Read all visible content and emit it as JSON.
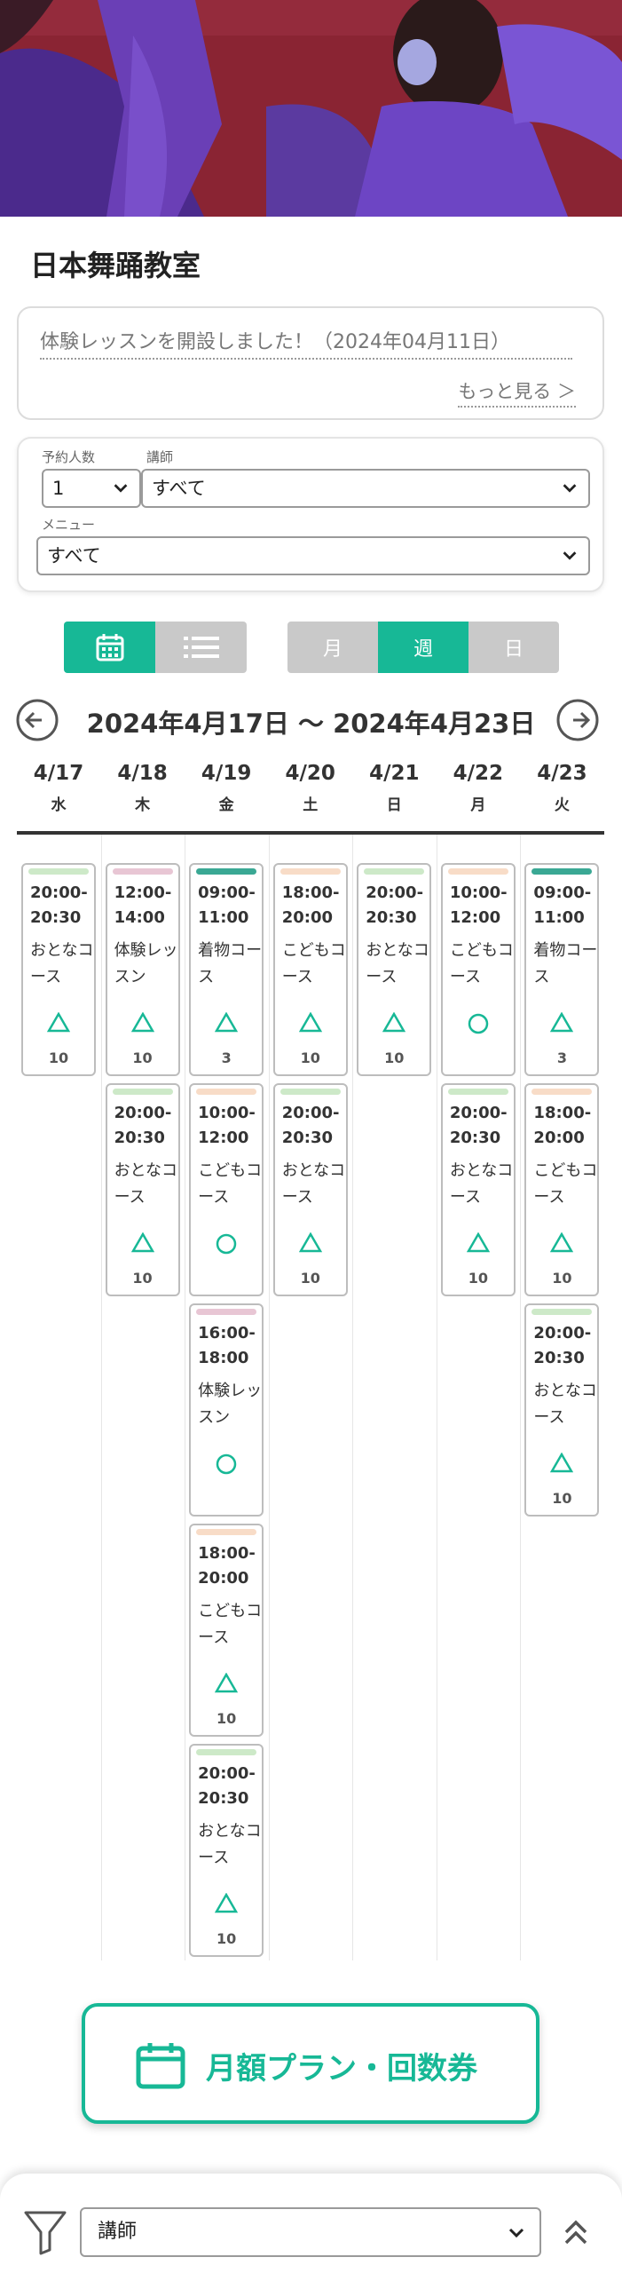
{
  "studio": {
    "title": "日本舞踊教室"
  },
  "notice": {
    "text": "体験レッスンを開設しました！（2024年04月11日）",
    "more": "もっと見る ＞"
  },
  "filters": {
    "people_label": "予約人数",
    "people_value": "1",
    "teacher_label": "講師",
    "teacher_value": "すべて",
    "menu_label": "メニュー",
    "menu_value": "すべて"
  },
  "view_toggle": {
    "calendar_icon": "calendar-icon",
    "list_icon": "list-icon"
  },
  "period": {
    "month": "月",
    "week": "週",
    "day": "日",
    "active": "week"
  },
  "range": {
    "text": "2024年4月17日 〜 2024年4月23日"
  },
  "days": [
    {
      "date": "4/17",
      "weekday": "水"
    },
    {
      "date": "4/18",
      "weekday": "木"
    },
    {
      "date": "4/19",
      "weekday": "金"
    },
    {
      "date": "4/20",
      "weekday": "土"
    },
    {
      "date": "4/21",
      "weekday": "日"
    },
    {
      "date": "4/22",
      "weekday": "月"
    },
    {
      "date": "4/23",
      "weekday": "火"
    }
  ],
  "colors": {
    "accent": "#17b896",
    "otona": "#cde9c8",
    "taiken": "#e8c6d4",
    "kodomo": "#f8dcc7",
    "kimono": "#3aa894"
  },
  "slots": [
    {
      "day": 0,
      "row": 0,
      "time1": "20:00-",
      "time2": "20:30",
      "name": "おとなコース",
      "mark": "triangle",
      "cap": "10",
      "color": "otona"
    },
    {
      "day": 1,
      "row": 0,
      "time1": "12:00-",
      "time2": "14:00",
      "name": "体験レッスン",
      "mark": "triangle",
      "cap": "10",
      "color": "taiken"
    },
    {
      "day": 1,
      "row": 1,
      "time1": "20:00-",
      "time2": "20:30",
      "name": "おとなコース",
      "mark": "triangle",
      "cap": "10",
      "color": "otona"
    },
    {
      "day": 2,
      "row": 0,
      "time1": "09:00-",
      "time2": "11:00",
      "name": "着物コース",
      "mark": "triangle",
      "cap": "3",
      "color": "kimono"
    },
    {
      "day": 2,
      "row": 1,
      "time1": "10:00-",
      "time2": "12:00",
      "name": "こどもコース",
      "mark": "circle",
      "cap": "",
      "color": "kodomo"
    },
    {
      "day": 2,
      "row": 2,
      "time1": "16:00-",
      "time2": "18:00",
      "name": "体験レッスン",
      "mark": "circle",
      "cap": "",
      "color": "taiken"
    },
    {
      "day": 2,
      "row": 3,
      "time1": "18:00-",
      "time2": "20:00",
      "name": "こどもコース",
      "mark": "triangle",
      "cap": "10",
      "color": "kodomo"
    },
    {
      "day": 2,
      "row": 4,
      "time1": "20:00-",
      "time2": "20:30",
      "name": "おとなコース",
      "mark": "triangle",
      "cap": "10",
      "color": "otona"
    },
    {
      "day": 3,
      "row": 0,
      "time1": "18:00-",
      "time2": "20:00",
      "name": "こどもコース",
      "mark": "triangle",
      "cap": "10",
      "color": "kodomo"
    },
    {
      "day": 3,
      "row": 1,
      "time1": "20:00-",
      "time2": "20:30",
      "name": "おとなコース",
      "mark": "triangle",
      "cap": "10",
      "color": "otona"
    },
    {
      "day": 4,
      "row": 0,
      "time1": "20:00-",
      "time2": "20:30",
      "name": "おとなコース",
      "mark": "triangle",
      "cap": "10",
      "color": "otona"
    },
    {
      "day": 5,
      "row": 0,
      "time1": "10:00-",
      "time2": "12:00",
      "name": "こどもコース",
      "mark": "circle",
      "cap": "",
      "color": "kodomo"
    },
    {
      "day": 5,
      "row": 1,
      "time1": "20:00-",
      "time2": "20:30",
      "name": "おとなコース",
      "mark": "triangle",
      "cap": "10",
      "color": "otona"
    },
    {
      "day": 6,
      "row": 0,
      "time1": "09:00-",
      "time2": "11:00",
      "name": "着物コース",
      "mark": "triangle",
      "cap": "3",
      "color": "kimono"
    },
    {
      "day": 6,
      "row": 1,
      "time1": "18:00-",
      "time2": "20:00",
      "name": "こどもコース",
      "mark": "triangle",
      "cap": "10",
      "color": "kodomo"
    },
    {
      "day": 6,
      "row": 2,
      "time1": "20:00-",
      "time2": "20:30",
      "name": "おとなコース",
      "mark": "triangle",
      "cap": "10",
      "color": "otona"
    }
  ],
  "plan": {
    "label": "月額プラン・回数券"
  },
  "bottom": {
    "filter_value": "講師"
  }
}
